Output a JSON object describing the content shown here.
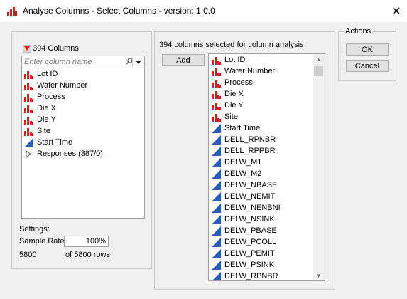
{
  "window": {
    "title": "Analyse Columns - Select Columns - version: 1.0.0",
    "close_label": "✕",
    "icons": {
      "app": "jmp-app-icon",
      "close": "close-icon"
    }
  },
  "left": {
    "columns_count_label": "394 Columns",
    "search_placeholder": "Enter column name",
    "items": [
      {
        "label": "Lot ID",
        "icon": "nominal-bar-icon"
      },
      {
        "label": "Wafer Number",
        "icon": "nominal-bar-icon"
      },
      {
        "label": "Process",
        "icon": "nominal-bar-icon"
      },
      {
        "label": "Die X",
        "icon": "nominal-bar-icon"
      },
      {
        "label": "Die Y",
        "icon": "nominal-bar-icon"
      },
      {
        "label": "Site",
        "icon": "nominal-bar-icon"
      },
      {
        "label": "Start Time",
        "icon": "continuous-triangle-icon"
      },
      {
        "label": "Responses (387/0)",
        "icon": "expand-arrow-icon"
      }
    ],
    "settings_label": "Settings:",
    "sample_rate_label": "Sample Rate",
    "sample_rate_value": "100%",
    "rows_count": "5800",
    "rows_of_label": "of 5800 rows"
  },
  "middle": {
    "selected_label": "394 columns selected for column analysis",
    "add_label": "Add",
    "items": [
      {
        "label": "Lot ID",
        "icon": "nominal-bar-icon"
      },
      {
        "label": "Wafer Number",
        "icon": "nominal-bar-icon"
      },
      {
        "label": "Process",
        "icon": "nominal-bar-icon"
      },
      {
        "label": "Die X",
        "icon": "nominal-bar-icon"
      },
      {
        "label": "Die Y",
        "icon": "nominal-bar-icon"
      },
      {
        "label": "Site",
        "icon": "nominal-bar-icon"
      },
      {
        "label": "Start Time",
        "icon": "continuous-triangle-icon"
      },
      {
        "label": "DELL_RPNBR",
        "icon": "continuous-triangle-icon"
      },
      {
        "label": "DELL_RPPBR",
        "icon": "continuous-triangle-icon"
      },
      {
        "label": "DELW_M1",
        "icon": "continuous-triangle-icon"
      },
      {
        "label": "DELW_M2",
        "icon": "continuous-triangle-icon"
      },
      {
        "label": "DELW_NBASE",
        "icon": "continuous-triangle-icon"
      },
      {
        "label": "DELW_NEMIT",
        "icon": "continuous-triangle-icon"
      },
      {
        "label": "DELW_NENBNI",
        "icon": "continuous-triangle-icon"
      },
      {
        "label": "DELW_NSINK",
        "icon": "continuous-triangle-icon"
      },
      {
        "label": "DELW_PBASE",
        "icon": "continuous-triangle-icon"
      },
      {
        "label": "DELW_PCOLL",
        "icon": "continuous-triangle-icon"
      },
      {
        "label": "DELW_PEMIT",
        "icon": "continuous-triangle-icon"
      },
      {
        "label": "DELW_PSINK",
        "icon": "continuous-triangle-icon"
      },
      {
        "label": "DELW_RPNBR",
        "icon": "continuous-triangle-icon"
      }
    ]
  },
  "actions": {
    "legend": "Actions",
    "ok_label": "OK",
    "cancel_label": "Cancel"
  },
  "colors": {
    "nominal_red": "#c0261c",
    "continuous_blue": "#2a5bb0",
    "dropdown_red": "#d02020"
  }
}
